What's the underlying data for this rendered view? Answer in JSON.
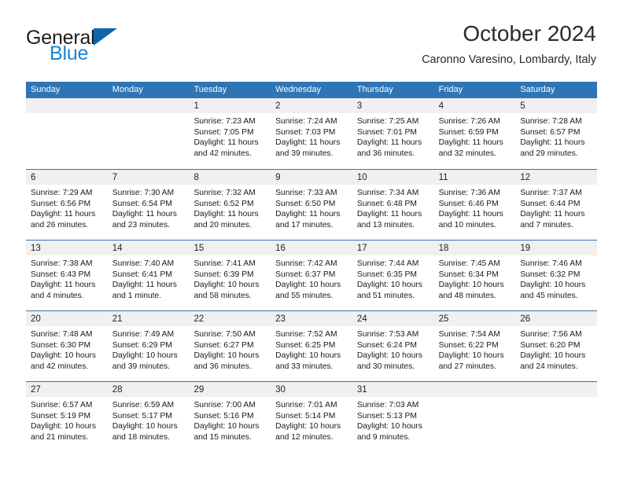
{
  "brand": {
    "line1": "General",
    "line2": "Blue",
    "logo_icon": "triangle-icon",
    "color_dark": "#1d1d1d",
    "color_blue": "#1a84d6",
    "color_triangle": "#1263ad"
  },
  "header": {
    "month_title": "October 2024",
    "location": "Caronno Varesino, Lombardy, Italy"
  },
  "colors": {
    "header_blue": "#2e75b6",
    "day_band_gray": "#f0f0f0",
    "text": "#1a1a1a"
  },
  "weekdays": [
    "Sunday",
    "Monday",
    "Tuesday",
    "Wednesday",
    "Thursday",
    "Friday",
    "Saturday"
  ],
  "weeks": [
    [
      {
        "day": "",
        "empty": true
      },
      {
        "day": "",
        "empty": true
      },
      {
        "day": "1",
        "sunrise": "Sunrise: 7:23 AM",
        "sunset": "Sunset: 7:05 PM",
        "daylight1": "Daylight: 11 hours",
        "daylight2": "and 42 minutes."
      },
      {
        "day": "2",
        "sunrise": "Sunrise: 7:24 AM",
        "sunset": "Sunset: 7:03 PM",
        "daylight1": "Daylight: 11 hours",
        "daylight2": "and 39 minutes."
      },
      {
        "day": "3",
        "sunrise": "Sunrise: 7:25 AM",
        "sunset": "Sunset: 7:01 PM",
        "daylight1": "Daylight: 11 hours",
        "daylight2": "and 36 minutes."
      },
      {
        "day": "4",
        "sunrise": "Sunrise: 7:26 AM",
        "sunset": "Sunset: 6:59 PM",
        "daylight1": "Daylight: 11 hours",
        "daylight2": "and 32 minutes."
      },
      {
        "day": "5",
        "sunrise": "Sunrise: 7:28 AM",
        "sunset": "Sunset: 6:57 PM",
        "daylight1": "Daylight: 11 hours",
        "daylight2": "and 29 minutes."
      }
    ],
    [
      {
        "day": "6",
        "sunrise": "Sunrise: 7:29 AM",
        "sunset": "Sunset: 6:56 PM",
        "daylight1": "Daylight: 11 hours",
        "daylight2": "and 26 minutes."
      },
      {
        "day": "7",
        "sunrise": "Sunrise: 7:30 AM",
        "sunset": "Sunset: 6:54 PM",
        "daylight1": "Daylight: 11 hours",
        "daylight2": "and 23 minutes."
      },
      {
        "day": "8",
        "sunrise": "Sunrise: 7:32 AM",
        "sunset": "Sunset: 6:52 PM",
        "daylight1": "Daylight: 11 hours",
        "daylight2": "and 20 minutes."
      },
      {
        "day": "9",
        "sunrise": "Sunrise: 7:33 AM",
        "sunset": "Sunset: 6:50 PM",
        "daylight1": "Daylight: 11 hours",
        "daylight2": "and 17 minutes."
      },
      {
        "day": "10",
        "sunrise": "Sunrise: 7:34 AM",
        "sunset": "Sunset: 6:48 PM",
        "daylight1": "Daylight: 11 hours",
        "daylight2": "and 13 minutes."
      },
      {
        "day": "11",
        "sunrise": "Sunrise: 7:36 AM",
        "sunset": "Sunset: 6:46 PM",
        "daylight1": "Daylight: 11 hours",
        "daylight2": "and 10 minutes."
      },
      {
        "day": "12",
        "sunrise": "Sunrise: 7:37 AM",
        "sunset": "Sunset: 6:44 PM",
        "daylight1": "Daylight: 11 hours",
        "daylight2": "and 7 minutes."
      }
    ],
    [
      {
        "day": "13",
        "sunrise": "Sunrise: 7:38 AM",
        "sunset": "Sunset: 6:43 PM",
        "daylight1": "Daylight: 11 hours",
        "daylight2": "and 4 minutes."
      },
      {
        "day": "14",
        "sunrise": "Sunrise: 7:40 AM",
        "sunset": "Sunset: 6:41 PM",
        "daylight1": "Daylight: 11 hours",
        "daylight2": "and 1 minute."
      },
      {
        "day": "15",
        "sunrise": "Sunrise: 7:41 AM",
        "sunset": "Sunset: 6:39 PM",
        "daylight1": "Daylight: 10 hours",
        "daylight2": "and 58 minutes."
      },
      {
        "day": "16",
        "sunrise": "Sunrise: 7:42 AM",
        "sunset": "Sunset: 6:37 PM",
        "daylight1": "Daylight: 10 hours",
        "daylight2": "and 55 minutes."
      },
      {
        "day": "17",
        "sunrise": "Sunrise: 7:44 AM",
        "sunset": "Sunset: 6:35 PM",
        "daylight1": "Daylight: 10 hours",
        "daylight2": "and 51 minutes."
      },
      {
        "day": "18",
        "sunrise": "Sunrise: 7:45 AM",
        "sunset": "Sunset: 6:34 PM",
        "daylight1": "Daylight: 10 hours",
        "daylight2": "and 48 minutes."
      },
      {
        "day": "19",
        "sunrise": "Sunrise: 7:46 AM",
        "sunset": "Sunset: 6:32 PM",
        "daylight1": "Daylight: 10 hours",
        "daylight2": "and 45 minutes."
      }
    ],
    [
      {
        "day": "20",
        "sunrise": "Sunrise: 7:48 AM",
        "sunset": "Sunset: 6:30 PM",
        "daylight1": "Daylight: 10 hours",
        "daylight2": "and 42 minutes."
      },
      {
        "day": "21",
        "sunrise": "Sunrise: 7:49 AM",
        "sunset": "Sunset: 6:29 PM",
        "daylight1": "Daylight: 10 hours",
        "daylight2": "and 39 minutes."
      },
      {
        "day": "22",
        "sunrise": "Sunrise: 7:50 AM",
        "sunset": "Sunset: 6:27 PM",
        "daylight1": "Daylight: 10 hours",
        "daylight2": "and 36 minutes."
      },
      {
        "day": "23",
        "sunrise": "Sunrise: 7:52 AM",
        "sunset": "Sunset: 6:25 PM",
        "daylight1": "Daylight: 10 hours",
        "daylight2": "and 33 minutes."
      },
      {
        "day": "24",
        "sunrise": "Sunrise: 7:53 AM",
        "sunset": "Sunset: 6:24 PM",
        "daylight1": "Daylight: 10 hours",
        "daylight2": "and 30 minutes."
      },
      {
        "day": "25",
        "sunrise": "Sunrise: 7:54 AM",
        "sunset": "Sunset: 6:22 PM",
        "daylight1": "Daylight: 10 hours",
        "daylight2": "and 27 minutes."
      },
      {
        "day": "26",
        "sunrise": "Sunrise: 7:56 AM",
        "sunset": "Sunset: 6:20 PM",
        "daylight1": "Daylight: 10 hours",
        "daylight2": "and 24 minutes."
      }
    ],
    [
      {
        "day": "27",
        "sunrise": "Sunrise: 6:57 AM",
        "sunset": "Sunset: 5:19 PM",
        "daylight1": "Daylight: 10 hours",
        "daylight2": "and 21 minutes."
      },
      {
        "day": "28",
        "sunrise": "Sunrise: 6:59 AM",
        "sunset": "Sunset: 5:17 PM",
        "daylight1": "Daylight: 10 hours",
        "daylight2": "and 18 minutes."
      },
      {
        "day": "29",
        "sunrise": "Sunrise: 7:00 AM",
        "sunset": "Sunset: 5:16 PM",
        "daylight1": "Daylight: 10 hours",
        "daylight2": "and 15 minutes."
      },
      {
        "day": "30",
        "sunrise": "Sunrise: 7:01 AM",
        "sunset": "Sunset: 5:14 PM",
        "daylight1": "Daylight: 10 hours",
        "daylight2": "and 12 minutes."
      },
      {
        "day": "31",
        "sunrise": "Sunrise: 7:03 AM",
        "sunset": "Sunset: 5:13 PM",
        "daylight1": "Daylight: 10 hours",
        "daylight2": "and 9 minutes."
      },
      {
        "day": "",
        "empty": true
      },
      {
        "day": "",
        "empty": true
      }
    ]
  ]
}
